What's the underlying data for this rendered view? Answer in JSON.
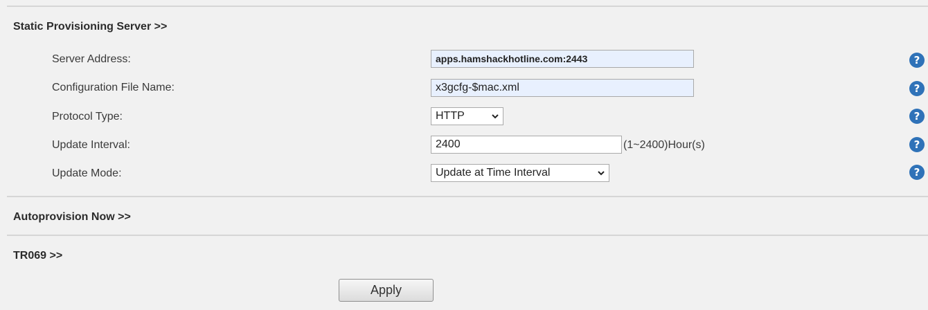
{
  "sections": {
    "static_provisioning": "Static Provisioning Server >>",
    "autoprovision_now": "Autoprovision Now >>",
    "tr069": "TR069 >>"
  },
  "fields": {
    "server_address": {
      "label": "Server Address:",
      "value": "apps.hamshackhotline.com:2443"
    },
    "config_file_name": {
      "label": "Configuration File Name:",
      "value": "x3gcfg-$mac.xml"
    },
    "protocol_type": {
      "label": "Protocol Type:",
      "selected": "HTTP"
    },
    "update_interval": {
      "label": "Update Interval:",
      "value": "2400",
      "hint": "(1~2400)Hour(s)"
    },
    "update_mode": {
      "label": "Update Mode:",
      "selected": "Update at Time Interval"
    }
  },
  "help_icon": {
    "glyph": "?",
    "color": "#2f72b8"
  },
  "apply_label": "Apply"
}
